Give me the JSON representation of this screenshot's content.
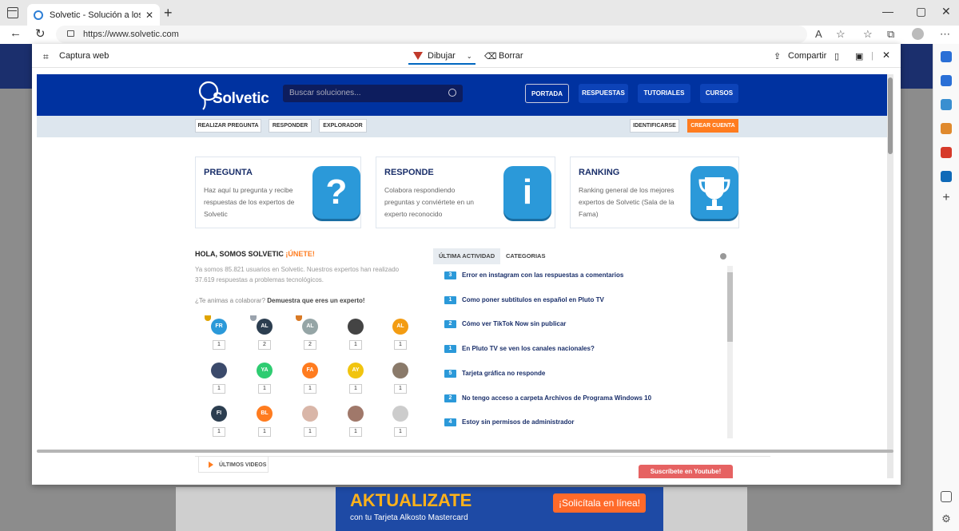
{
  "browser": {
    "tab_title": "Solvetic - Solución a los problem",
    "url": "https://www.solvetic.com"
  },
  "capture": {
    "title": "Captura web",
    "draw": "Dibujar",
    "erase": "Borrar",
    "share": "Compartir"
  },
  "site": {
    "logo": "Solvetic",
    "search_placeholder": "Buscar soluciones...",
    "nav": [
      "PORTADA",
      "RESPUESTAS",
      "TUTORIALES",
      "CURSOS"
    ],
    "subnav": [
      "REALIZAR PREGUNTA",
      "RESPONDER",
      "EXPLORADOR"
    ],
    "login": "IDENTIFICARSE",
    "signup": "CREAR CUENTA",
    "cards": [
      {
        "title": "PREGUNTA",
        "desc": "Haz aquí tu pregunta y recibe respuestas de los expertos de Solvetic",
        "icon": "?"
      },
      {
        "title": "RESPONDE",
        "desc": "Colabora respondiendo preguntas y conviértete en un experto reconocido",
        "icon": "i"
      },
      {
        "title": "RANKING",
        "desc": "Ranking general de los mejores expertos de Solvetic (Sala de la Fama)",
        "icon": "trophy"
      }
    ],
    "hola_title": "HOLA, SOMOS SOLVETIC",
    "hola_join": "¡ÚNETE!",
    "hola_desc": "Ya somos 85.821 usuarios en Solvetic. Nuestros expertos han realizado 37.619 respuestas a problemas tecnológicos.",
    "hola_q": "¿Te animas a colaborar?",
    "hola_q_b": "Demuestra que eres un experto!",
    "users": [
      {
        "ini": "FR",
        "count": "1",
        "color": "#2b99d9"
      },
      {
        "ini": "AL",
        "count": "2",
        "color": "#2c3e50"
      },
      {
        "ini": "AL",
        "count": "2",
        "color": "#95a5a6"
      },
      {
        "ini": "",
        "count": "1",
        "color": "#444"
      },
      {
        "ini": "AL",
        "count": "1",
        "color": "#f39c12"
      },
      {
        "ini": "",
        "count": "1",
        "color": "#3b4a6b"
      },
      {
        "ini": "YA",
        "count": "1",
        "color": "#2ecc71"
      },
      {
        "ini": "FA",
        "count": "1",
        "color": "#ff7c1f"
      },
      {
        "ini": "AY",
        "count": "1",
        "color": "#f1c40f"
      },
      {
        "ini": "",
        "count": "1",
        "color": "#8a7a6a"
      },
      {
        "ini": "FI",
        "count": "1",
        "color": "#2c3e50"
      },
      {
        "ini": "BL",
        "count": "1",
        "color": "#ff7c1f"
      },
      {
        "ini": "",
        "count": "1",
        "color": "#d9b6a8"
      },
      {
        "ini": "",
        "count": "1",
        "color": "#a0786a"
      },
      {
        "ini": "",
        "count": "1",
        "color": "#ccc"
      }
    ],
    "activity_tabs": [
      "ÚLTIMA ACTIVIDAD",
      "CATEGORIAS"
    ],
    "activity": [
      {
        "n": "3",
        "t": "Error en instagram con las respuestas a comentarios"
      },
      {
        "n": "1",
        "t": "Como poner subtitulos en español en Pluto TV"
      },
      {
        "n": "2",
        "t": "Cómo ver TikTok Now sin publicar"
      },
      {
        "n": "1",
        "t": "En Pluto TV se ven los canales nacionales?"
      },
      {
        "n": "5",
        "t": "Tarjeta gráfica no responde"
      },
      {
        "n": "2",
        "t": "No tengo acceso a carpeta Archivos de Programa Windows 10"
      },
      {
        "n": "4",
        "t": "Estoy sin permisos de administrador"
      }
    ],
    "videos_tab": "ÚLTIMOS VIDEOS",
    "youtube": "Suscríbete en Youtube!"
  },
  "ad": {
    "title": "AKTUALIZATE",
    "sub": "con tu Tarjeta Alkosto Mastercard",
    "cta": "¡Solicítala en línea!"
  }
}
